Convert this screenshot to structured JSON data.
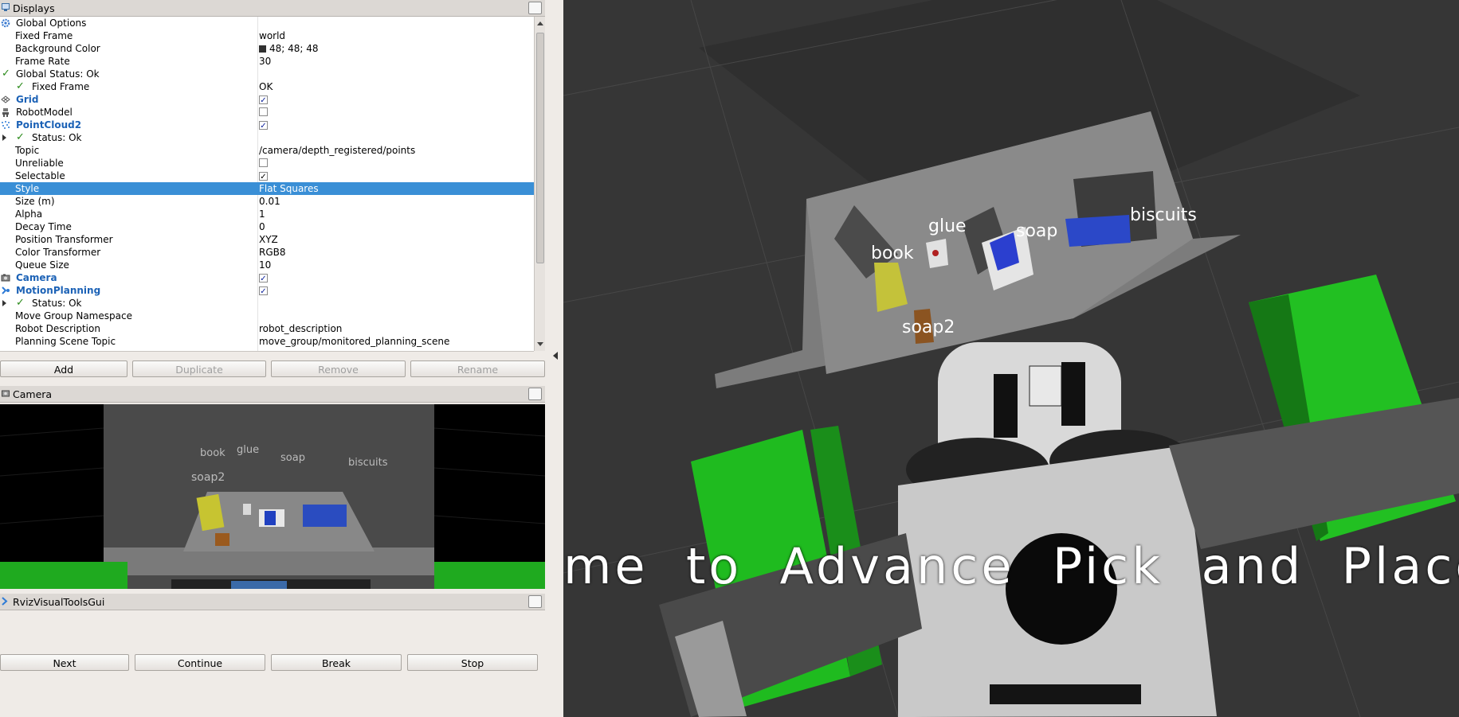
{
  "displays_panel": {
    "title": "Displays",
    "rows": [
      {
        "label": "Global Options",
        "value": ""
      },
      {
        "label": "Fixed Frame",
        "value": "world"
      },
      {
        "label": "Background Color",
        "value": "48; 48; 48"
      },
      {
        "label": "Frame Rate",
        "value": "30"
      },
      {
        "label": "Global Status: Ok",
        "value": ""
      },
      {
        "label": "Fixed Frame",
        "value": "OK"
      },
      {
        "label": "Grid",
        "value": ""
      },
      {
        "label": "RobotModel",
        "value": ""
      },
      {
        "label": "PointCloud2",
        "value": ""
      },
      {
        "label": "Status: Ok",
        "value": ""
      },
      {
        "label": "Topic",
        "value": "/camera/depth_registered/points"
      },
      {
        "label": "Unreliable",
        "value": ""
      },
      {
        "label": "Selectable",
        "value": ""
      },
      {
        "label": "Style",
        "value": "Flat Squares"
      },
      {
        "label": "Size (m)",
        "value": "0.01"
      },
      {
        "label": "Alpha",
        "value": "1"
      },
      {
        "label": "Decay Time",
        "value": "0"
      },
      {
        "label": "Position Transformer",
        "value": "XYZ"
      },
      {
        "label": "Color Transformer",
        "value": "RGB8"
      },
      {
        "label": "Queue Size",
        "value": "10"
      },
      {
        "label": "Camera",
        "value": ""
      },
      {
        "label": "MotionPlanning",
        "value": ""
      },
      {
        "label": "Status: Ok",
        "value": ""
      },
      {
        "label": "Move Group Namespace",
        "value": ""
      },
      {
        "label": "Robot Description",
        "value": "robot_description"
      },
      {
        "label": "Planning Scene Topic",
        "value": "move_group/monitored_planning_scene"
      }
    ],
    "buttons": {
      "add": "Add",
      "duplicate": "Duplicate",
      "remove": "Remove",
      "rename": "Rename"
    }
  },
  "camera_panel": {
    "title": "Camera",
    "labels": [
      "book",
      "glue",
      "soap",
      "biscuits",
      "soap2"
    ]
  },
  "rviz_tools_panel": {
    "title": "RvizVisualToolsGui",
    "buttons": {
      "next": "Next",
      "continue": "Continue",
      "break": "Break",
      "stop": "Stop"
    }
  },
  "viewport": {
    "object_labels": {
      "book": "book",
      "glue": "glue",
      "soap": "soap",
      "biscuits": "biscuits",
      "soap2": "soap2"
    },
    "banner": "me  to  Advance  Pick  and  Place",
    "background_color": "#303030"
  },
  "icons": [
    "gear-icon",
    "check-icon",
    "grid-icon",
    "robot-icon",
    "pointcloud-icon",
    "camera-icon",
    "motion-planning-icon",
    "expand-arrow-icon"
  ]
}
